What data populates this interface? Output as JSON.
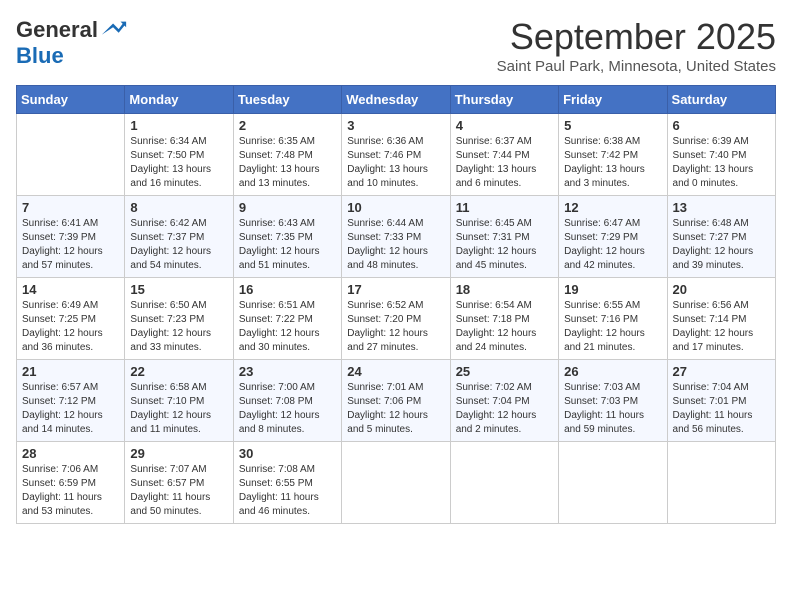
{
  "header": {
    "logo_general": "General",
    "logo_blue": "Blue",
    "month_title": "September 2025",
    "location": "Saint Paul Park, Minnesota, United States"
  },
  "weekdays": [
    "Sunday",
    "Monday",
    "Tuesday",
    "Wednesday",
    "Thursday",
    "Friday",
    "Saturday"
  ],
  "weeks": [
    [
      {
        "day": "",
        "info": ""
      },
      {
        "day": "1",
        "info": "Sunrise: 6:34 AM\nSunset: 7:50 PM\nDaylight: 13 hours\nand 16 minutes."
      },
      {
        "day": "2",
        "info": "Sunrise: 6:35 AM\nSunset: 7:48 PM\nDaylight: 13 hours\nand 13 minutes."
      },
      {
        "day": "3",
        "info": "Sunrise: 6:36 AM\nSunset: 7:46 PM\nDaylight: 13 hours\nand 10 minutes."
      },
      {
        "day": "4",
        "info": "Sunrise: 6:37 AM\nSunset: 7:44 PM\nDaylight: 13 hours\nand 6 minutes."
      },
      {
        "day": "5",
        "info": "Sunrise: 6:38 AM\nSunset: 7:42 PM\nDaylight: 13 hours\nand 3 minutes."
      },
      {
        "day": "6",
        "info": "Sunrise: 6:39 AM\nSunset: 7:40 PM\nDaylight: 13 hours\nand 0 minutes."
      }
    ],
    [
      {
        "day": "7",
        "info": "Sunrise: 6:41 AM\nSunset: 7:39 PM\nDaylight: 12 hours\nand 57 minutes."
      },
      {
        "day": "8",
        "info": "Sunrise: 6:42 AM\nSunset: 7:37 PM\nDaylight: 12 hours\nand 54 minutes."
      },
      {
        "day": "9",
        "info": "Sunrise: 6:43 AM\nSunset: 7:35 PM\nDaylight: 12 hours\nand 51 minutes."
      },
      {
        "day": "10",
        "info": "Sunrise: 6:44 AM\nSunset: 7:33 PM\nDaylight: 12 hours\nand 48 minutes."
      },
      {
        "day": "11",
        "info": "Sunrise: 6:45 AM\nSunset: 7:31 PM\nDaylight: 12 hours\nand 45 minutes."
      },
      {
        "day": "12",
        "info": "Sunrise: 6:47 AM\nSunset: 7:29 PM\nDaylight: 12 hours\nand 42 minutes."
      },
      {
        "day": "13",
        "info": "Sunrise: 6:48 AM\nSunset: 7:27 PM\nDaylight: 12 hours\nand 39 minutes."
      }
    ],
    [
      {
        "day": "14",
        "info": "Sunrise: 6:49 AM\nSunset: 7:25 PM\nDaylight: 12 hours\nand 36 minutes."
      },
      {
        "day": "15",
        "info": "Sunrise: 6:50 AM\nSunset: 7:23 PM\nDaylight: 12 hours\nand 33 minutes."
      },
      {
        "day": "16",
        "info": "Sunrise: 6:51 AM\nSunset: 7:22 PM\nDaylight: 12 hours\nand 30 minutes."
      },
      {
        "day": "17",
        "info": "Sunrise: 6:52 AM\nSunset: 7:20 PM\nDaylight: 12 hours\nand 27 minutes."
      },
      {
        "day": "18",
        "info": "Sunrise: 6:54 AM\nSunset: 7:18 PM\nDaylight: 12 hours\nand 24 minutes."
      },
      {
        "day": "19",
        "info": "Sunrise: 6:55 AM\nSunset: 7:16 PM\nDaylight: 12 hours\nand 21 minutes."
      },
      {
        "day": "20",
        "info": "Sunrise: 6:56 AM\nSunset: 7:14 PM\nDaylight: 12 hours\nand 17 minutes."
      }
    ],
    [
      {
        "day": "21",
        "info": "Sunrise: 6:57 AM\nSunset: 7:12 PM\nDaylight: 12 hours\nand 14 minutes."
      },
      {
        "day": "22",
        "info": "Sunrise: 6:58 AM\nSunset: 7:10 PM\nDaylight: 12 hours\nand 11 minutes."
      },
      {
        "day": "23",
        "info": "Sunrise: 7:00 AM\nSunset: 7:08 PM\nDaylight: 12 hours\nand 8 minutes."
      },
      {
        "day": "24",
        "info": "Sunrise: 7:01 AM\nSunset: 7:06 PM\nDaylight: 12 hours\nand 5 minutes."
      },
      {
        "day": "25",
        "info": "Sunrise: 7:02 AM\nSunset: 7:04 PM\nDaylight: 12 hours\nand 2 minutes."
      },
      {
        "day": "26",
        "info": "Sunrise: 7:03 AM\nSunset: 7:03 PM\nDaylight: 11 hours\nand 59 minutes."
      },
      {
        "day": "27",
        "info": "Sunrise: 7:04 AM\nSunset: 7:01 PM\nDaylight: 11 hours\nand 56 minutes."
      }
    ],
    [
      {
        "day": "28",
        "info": "Sunrise: 7:06 AM\nSunset: 6:59 PM\nDaylight: 11 hours\nand 53 minutes."
      },
      {
        "day": "29",
        "info": "Sunrise: 7:07 AM\nSunset: 6:57 PM\nDaylight: 11 hours\nand 50 minutes."
      },
      {
        "day": "30",
        "info": "Sunrise: 7:08 AM\nSunset: 6:55 PM\nDaylight: 11 hours\nand 46 minutes."
      },
      {
        "day": "",
        "info": ""
      },
      {
        "day": "",
        "info": ""
      },
      {
        "day": "",
        "info": ""
      },
      {
        "day": "",
        "info": ""
      }
    ]
  ]
}
